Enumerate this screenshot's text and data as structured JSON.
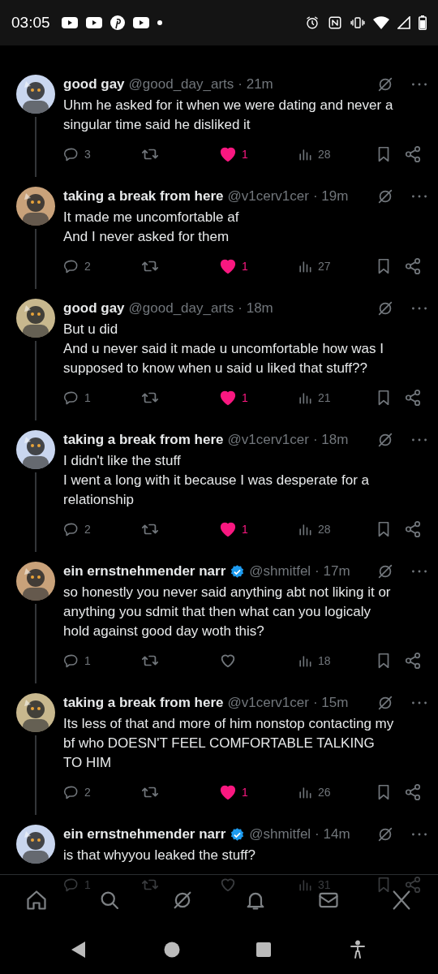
{
  "status_bar": {
    "time": "03:05"
  },
  "tweets": [
    {
      "name": "good gay",
      "verified": false,
      "handle": "@good_day_arts",
      "time": "· 21m",
      "body": [
        "Uhm he asked for it when we were dating and never a singular time said he disliked it"
      ],
      "replies": "3",
      "liked": true,
      "likes": "1",
      "views": "28"
    },
    {
      "name": "taking a break from here",
      "verified": false,
      "handle": "@v1cerv1cer",
      "time": "· 19m",
      "body": [
        "It made me uncomfortable af",
        "And I never asked for them"
      ],
      "replies": "2",
      "liked": true,
      "likes": "1",
      "views": "27"
    },
    {
      "name": "good gay",
      "verified": false,
      "handle": "@good_day_arts",
      "time": "· 18m",
      "body": [
        "But u did",
        "And u never said it made u uncomfortable how was I supposed to know when u said u liked that stuff??"
      ],
      "replies": "1",
      "liked": true,
      "likes": "1",
      "views": "21"
    },
    {
      "name": "taking a break from here",
      "verified": false,
      "handle": "@v1cerv1cer",
      "time": "· 18m",
      "body": [
        "I didn't like the stuff",
        "I went a long with it because I was desperate for a relationship"
      ],
      "replies": "2",
      "liked": true,
      "likes": "1",
      "views": "28"
    },
    {
      "name": "ein ernstnehmender narr",
      "verified": true,
      "handle": "@shmitfel",
      "time": "· 17m",
      "body": [
        "so honestly you never said anything abt not liking it or anything you sdmit that then what can you logicaly hold against good day woth this?"
      ],
      "replies": "1",
      "liked": false,
      "views": "18"
    },
    {
      "name": "taking a break from here",
      "verified": false,
      "handle": "@v1cerv1cer",
      "time": "· 15m",
      "body": [
        "Its less of that and more of him nonstop contacting my bf who DOESN'T FEEL COMFORTABLE TALKING TO HIM"
      ],
      "replies": "2",
      "liked": true,
      "likes": "1",
      "views": "26"
    },
    {
      "name": "ein ernstnehmender narr",
      "verified": true,
      "handle": "@shmitfel",
      "time": "· 14m",
      "body": [
        "is that whyyou leaked the stuff?"
      ],
      "replies": "1",
      "liked": false,
      "views": "31"
    }
  ]
}
